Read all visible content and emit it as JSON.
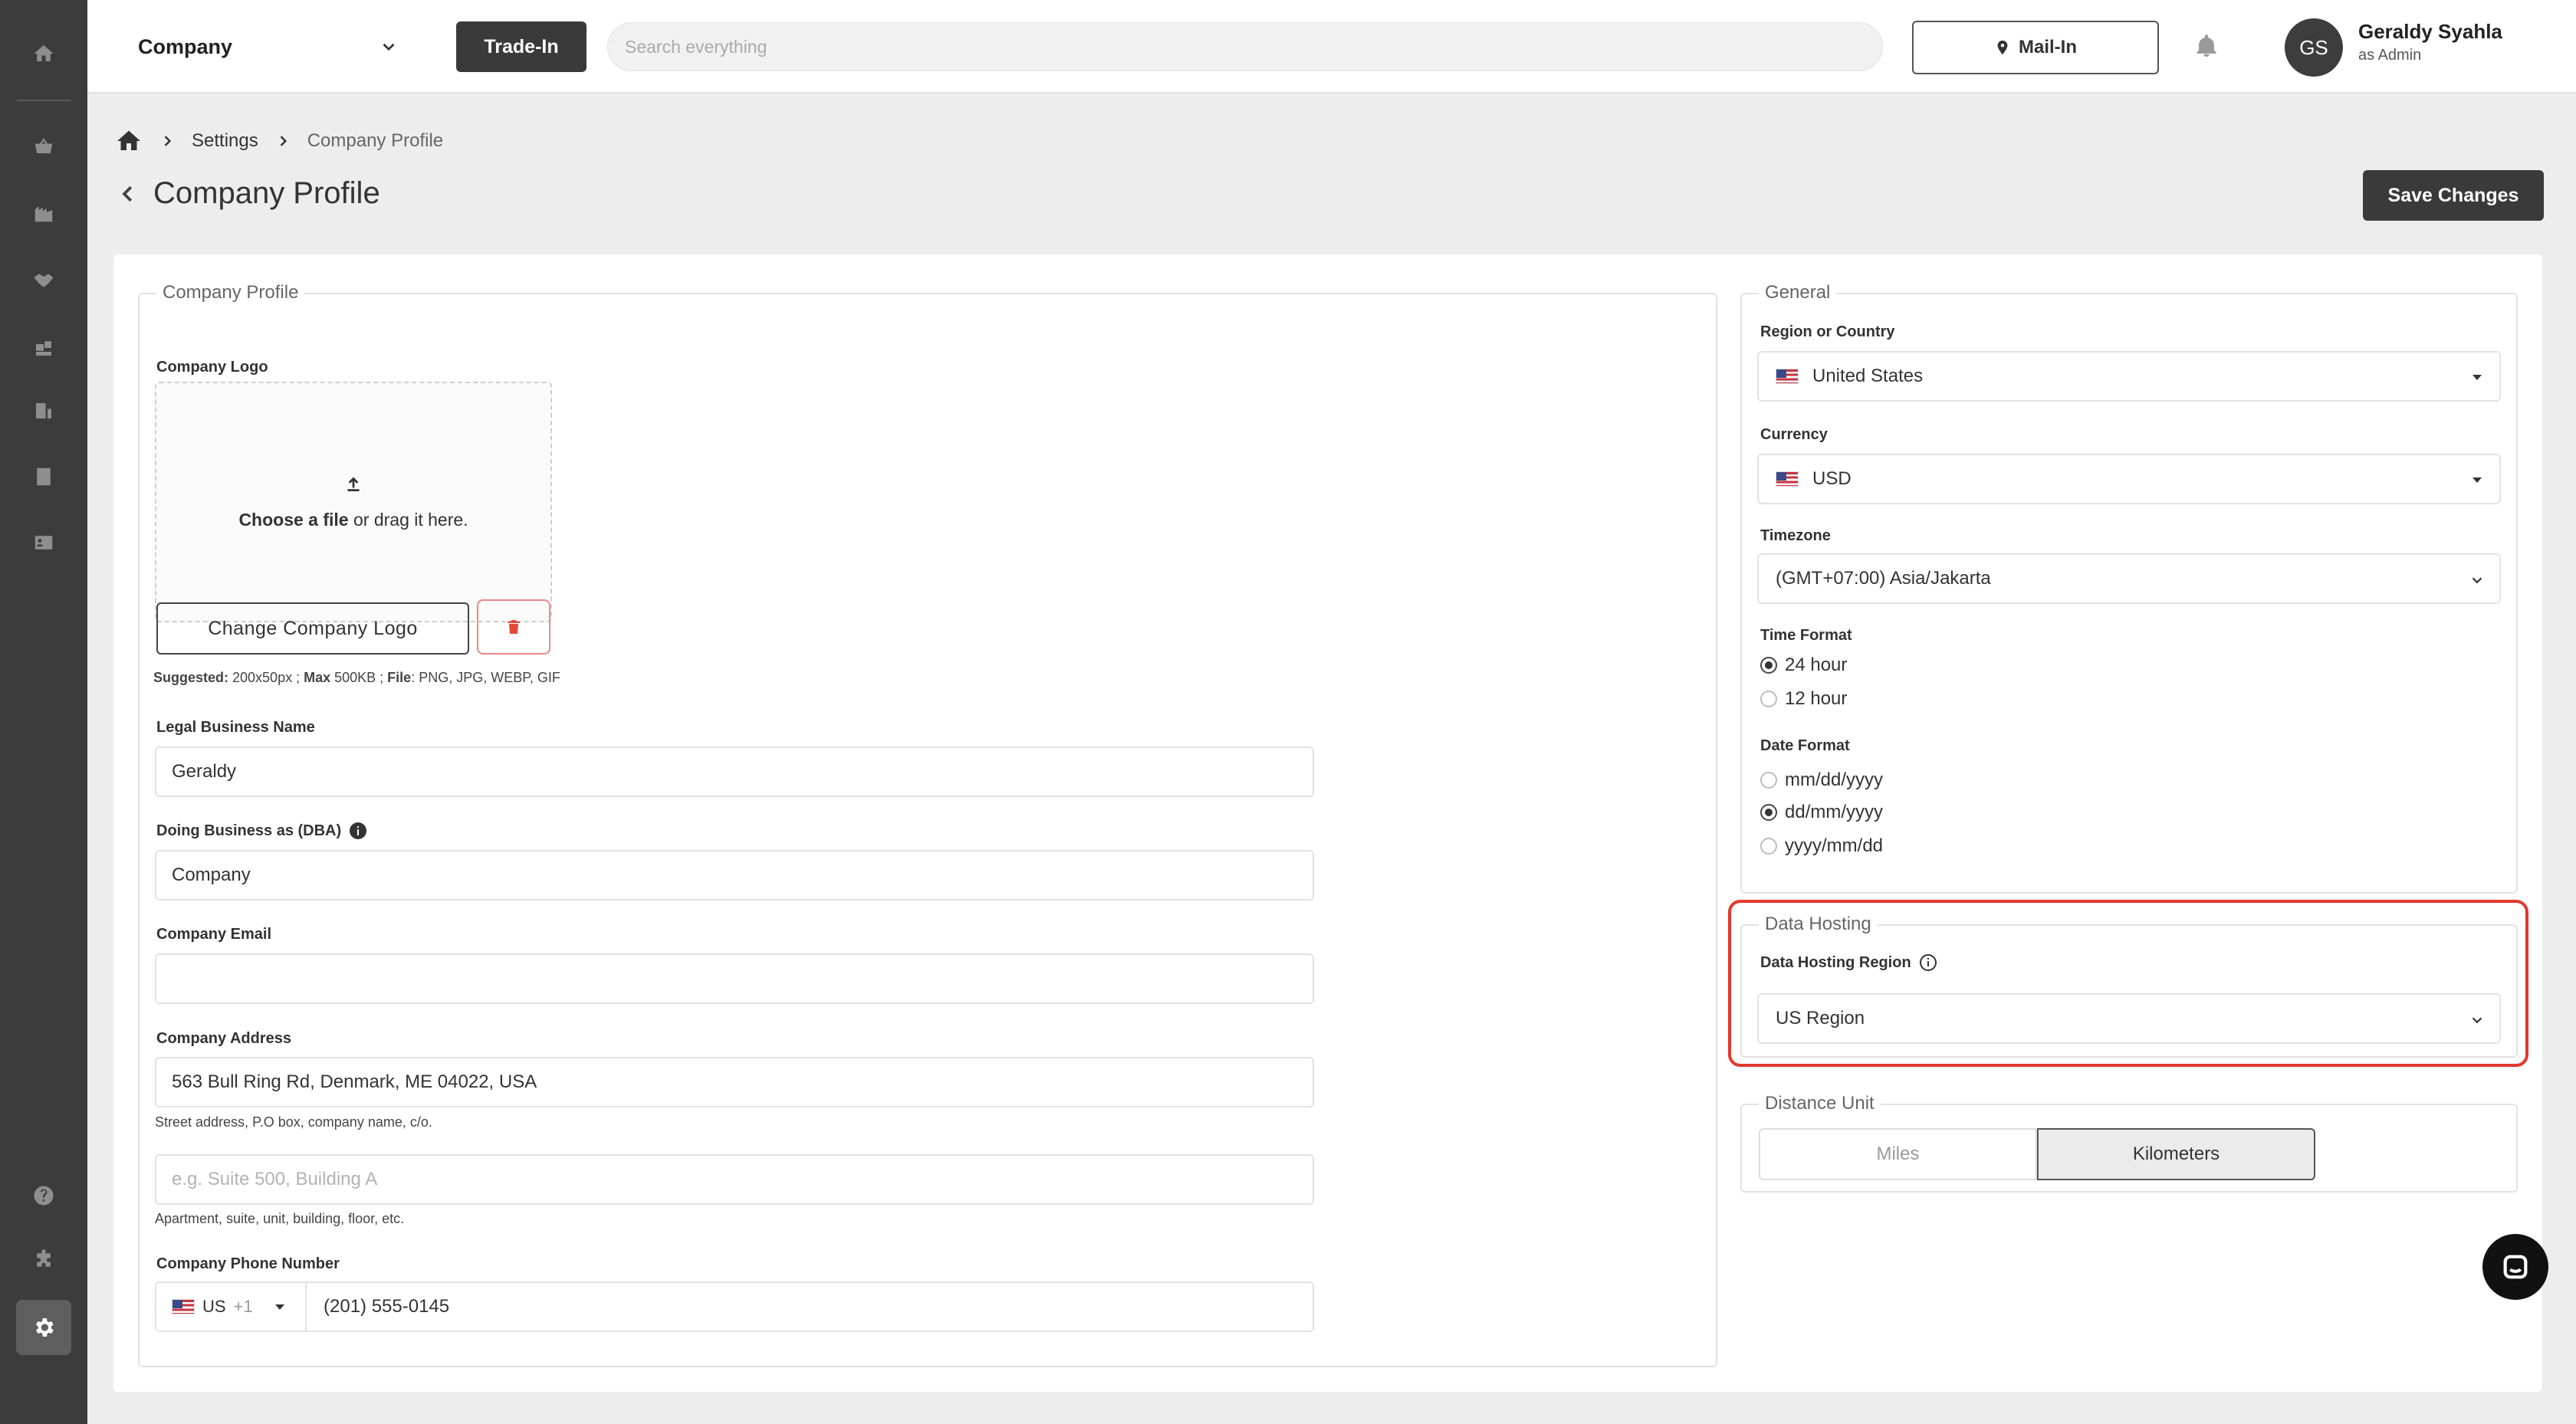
{
  "topbar": {
    "company": "Company",
    "trade_in": "Trade-In",
    "search_placeholder": "Search everything",
    "mail_in": "Mail-In",
    "avatar_initials": "GS",
    "user_name": "Geraldy Syahla",
    "user_role": "as Admin"
  },
  "breadcrumb": {
    "settings": "Settings",
    "current": "Company Profile"
  },
  "page": {
    "title": "Company Profile",
    "save": "Save Changes"
  },
  "profile": {
    "legend": "Company Profile",
    "logo_label": "Company Logo",
    "upload_bold": "Choose a file",
    "upload_rest": " or drag it here.",
    "change_logo": "Change Company Logo",
    "hint": {
      "suggested_label": "Suggested:",
      "suggested_value": " 200x50px ; ",
      "max_label": "Max",
      "max_value": " 500KB ; ",
      "file_label": "File",
      "file_value": ": PNG, JPG, WEBP, GIF"
    },
    "legal_name_label": "Legal Business Name",
    "legal_name_value": "Geraldy",
    "dba_label": "Doing Business as (DBA)",
    "dba_value": "Company",
    "email_label": "Company Email",
    "email_value": "",
    "address_label": "Company Address",
    "address_value": "563 Bull Ring Rd, Denmark, ME 04022, USA",
    "address_hint": "Street address, P.O box, company name, c/o.",
    "address2_placeholder": "e.g. Suite 500, Building A",
    "address2_hint": "Apartment, suite, unit, building, floor, etc.",
    "phone_label": "Company Phone Number",
    "phone_country": "US",
    "phone_code": "+1",
    "phone_value": "(201) 555-0145"
  },
  "general": {
    "legend": "General",
    "region_label": "Region or Country",
    "region_value": "United States",
    "currency_label": "Currency",
    "currency_value": "USD",
    "timezone_label": "Timezone",
    "timezone_value": "(GMT+07:00) Asia/Jakarta",
    "time_format_label": "Time Format",
    "time_24": "24 hour",
    "time_12": "12 hour",
    "time_selected": "24 hour",
    "date_format_label": "Date Format",
    "date_mdy": "mm/dd/yyyy",
    "date_dmy": "dd/mm/yyyy",
    "date_ymd": "yyyy/mm/dd",
    "date_selected": "dd/mm/yyyy"
  },
  "hosting": {
    "legend": "Data Hosting",
    "region_label": "Data Hosting Region",
    "region_value": "US Region",
    "highlight_color": "#e03a2f"
  },
  "distance": {
    "legend": "Distance Unit",
    "miles": "Miles",
    "kilometers": "Kilometers",
    "selected": "Kilometers"
  },
  "colors": {
    "sidebar": "#3c3c3c",
    "primary_button": "#3a3a3a",
    "danger": "#e24a3b"
  }
}
